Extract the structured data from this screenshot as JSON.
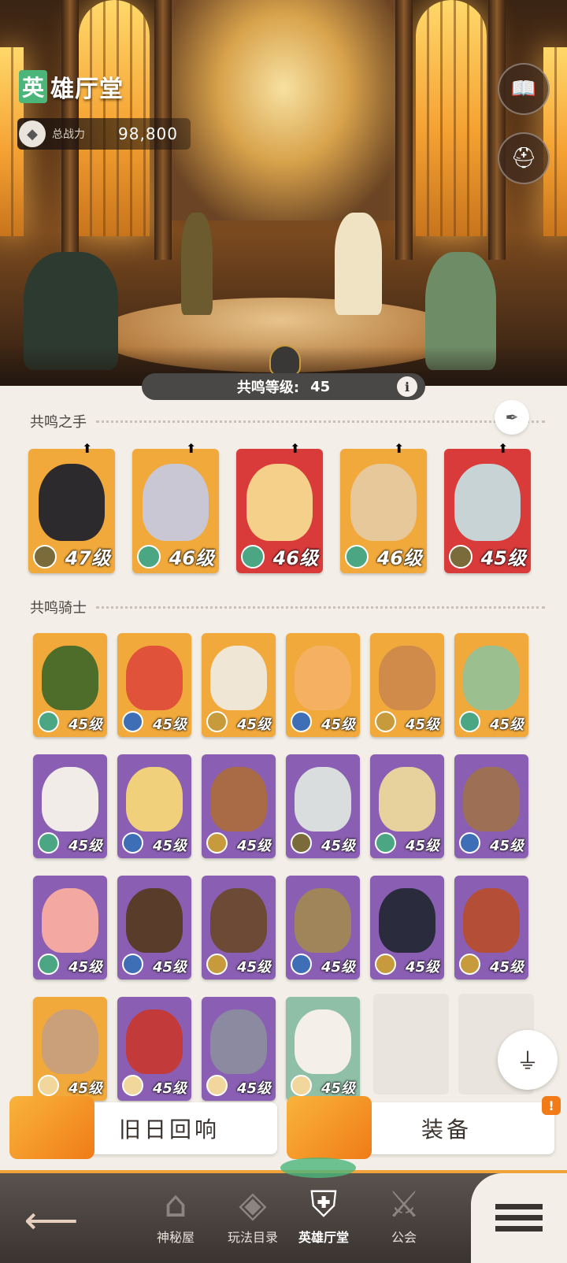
{
  "header": {
    "title_first_char": "英",
    "title_rest": "雄厅堂",
    "power_label": "总战力",
    "power_value": "98,800",
    "journal_icon": "journal-icon",
    "helmets_icon": "helmets-icon"
  },
  "resonance": {
    "label": "共鸣等级:",
    "level": "45",
    "info_glyph": "i"
  },
  "hands_section": {
    "title": "共鸣之手",
    "cards": [
      {
        "level": "47级",
        "bg": "#f2a93b",
        "face": "#2c2a2d",
        "faction": "#7b6b3a"
      },
      {
        "level": "46级",
        "bg": "#f2a93b",
        "face": "#c9c7d4",
        "faction": "#4ba783"
      },
      {
        "level": "46级",
        "bg": "#d93b3b",
        "face": "#f4d08a",
        "faction": "#4ba783"
      },
      {
        "level": "46级",
        "bg": "#f2a93b",
        "face": "#e6c89a",
        "faction": "#4ba783"
      },
      {
        "level": "45级",
        "bg": "#d93b3b",
        "face": "#c7d3d5",
        "faction": "#7b6b3a"
      }
    ]
  },
  "knights_section": {
    "title": "共鸣骑士",
    "cards": [
      {
        "level": "45级",
        "bg": "#f2a93b",
        "face": "#4e6d2a",
        "faction": "#4ba783"
      },
      {
        "level": "45级",
        "bg": "#f2a93b",
        "face": "#e0523a",
        "faction": "#3e6fb6"
      },
      {
        "level": "45级",
        "bg": "#f2a93b",
        "face": "#efe6d6",
        "faction": "#c79b3c"
      },
      {
        "level": "45级",
        "bg": "#f2a93b",
        "face": "#f5b062",
        "faction": "#3e6fb6"
      },
      {
        "level": "45级",
        "bg": "#f2a93b",
        "face": "#d08a4a",
        "faction": "#c79b3c"
      },
      {
        "level": "45级",
        "bg": "#f2a93b",
        "face": "#9bbf8f",
        "faction": "#4ba783"
      },
      {
        "level": "45级",
        "bg": "#8a5fb3",
        "face": "#f1ece8",
        "faction": "#4ba783"
      },
      {
        "level": "45级",
        "bg": "#8a5fb3",
        "face": "#f0d07a",
        "faction": "#3e6fb6"
      },
      {
        "level": "45级",
        "bg": "#8a5fb3",
        "face": "#a86b45",
        "faction": "#c79b3c"
      },
      {
        "level": "45级",
        "bg": "#8a5fb3",
        "face": "#d9dddd",
        "faction": "#7b6b3a"
      },
      {
        "level": "45级",
        "bg": "#8a5fb3",
        "face": "#e7d29e",
        "faction": "#4ba783"
      },
      {
        "level": "45级",
        "bg": "#8a5fb3",
        "face": "#9d7056",
        "faction": "#3e6fb6"
      },
      {
        "level": "45级",
        "bg": "#8a5fb3",
        "face": "#f3a8a2",
        "faction": "#4ba783"
      },
      {
        "level": "45级",
        "bg": "#8a5fb3",
        "face": "#5a3c2a",
        "faction": "#3e6fb6"
      },
      {
        "level": "45级",
        "bg": "#8a5fb3",
        "face": "#6c4a35",
        "faction": "#c79b3c"
      },
      {
        "level": "45级",
        "bg": "#8a5fb3",
        "face": "#a0855a",
        "faction": "#3e6fb6"
      },
      {
        "level": "45级",
        "bg": "#8a5fb3",
        "face": "#2a2b3d",
        "faction": "#c79b3c"
      },
      {
        "level": "45级",
        "bg": "#8a5fb3",
        "face": "#b44e36",
        "faction": "#c79b3c"
      },
      {
        "level": "45级",
        "bg": "#f2a93b",
        "face": "#c9a07a",
        "faction": "#f2d79c"
      },
      {
        "level": "45级",
        "bg": "#8a5fb3",
        "face": "#c23a3a",
        "faction": "#f2d79c"
      },
      {
        "level": "45级",
        "bg": "#8a5fb3",
        "face": "#8c8aa0",
        "faction": "#f2d79c"
      },
      {
        "level": "45级",
        "bg": "#8fbfa6",
        "face": "#f4efe8",
        "faction": "#f2d79c"
      }
    ]
  },
  "buttons": {
    "echoes_label": "旧日回响",
    "equipment_label": "装备",
    "equipment_notice": "!",
    "filter_icon": "filter-icon"
  },
  "nav": {
    "items": [
      {
        "label": "神秘屋",
        "icon": "mystery-house-icon"
      },
      {
        "label": "玩法目录",
        "icon": "game-modes-icon"
      },
      {
        "label": "英雄厅堂",
        "icon": "hero-hall-icon"
      },
      {
        "label": "公会",
        "icon": "guild-icon"
      }
    ]
  }
}
